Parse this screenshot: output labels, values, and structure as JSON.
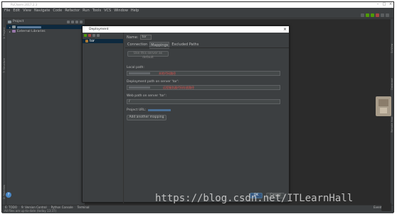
{
  "window": {
    "title": "PyCharm 2017.2.3"
  },
  "menu": [
    "File",
    "Edit",
    "View",
    "Navigate",
    "Code",
    "Refactor",
    "Run",
    "Tools",
    "VCS",
    "Window",
    "Help"
  ],
  "left_tools": [
    "1: Project",
    "7: Structure",
    "2: Favorites"
  ],
  "right_tools": [
    "SciView",
    "Database",
    "Remote Host"
  ],
  "project_panel": {
    "header": "Project",
    "items": [
      {
        "label": "External Libraries"
      }
    ]
  },
  "dialog": {
    "title": "Deployment",
    "server": "tor",
    "name_label": "Name:",
    "name_value": "tor",
    "tabs": [
      "Connection",
      "Mappings",
      "Excluded Paths"
    ],
    "active_tab": "Mappings",
    "default_button": "Use this server as default",
    "local_path_label": "Local path:",
    "local_path_note": "本地代码路径",
    "deploy_path_label": "Deployment path on server 'tor':",
    "deploy_path_note": "远程服务器代码存放路径",
    "web_path_label": "Web path on server 'tor':",
    "web_path_value": "/",
    "project_url_label": "Project URL:",
    "add_mapping_button": "Add another mapping",
    "ok_button": "OK",
    "cancel_button": "Cancel",
    "help_icon": "?"
  },
  "bottom_tabs": [
    "6: TODO",
    "9: Version Control",
    "Python Console",
    "Terminal"
  ],
  "event_log": "Event Log",
  "status": "All files are up-to-date (today 13:37)",
  "watermark": "https://blog.csdn.net/ITLearnHall"
}
